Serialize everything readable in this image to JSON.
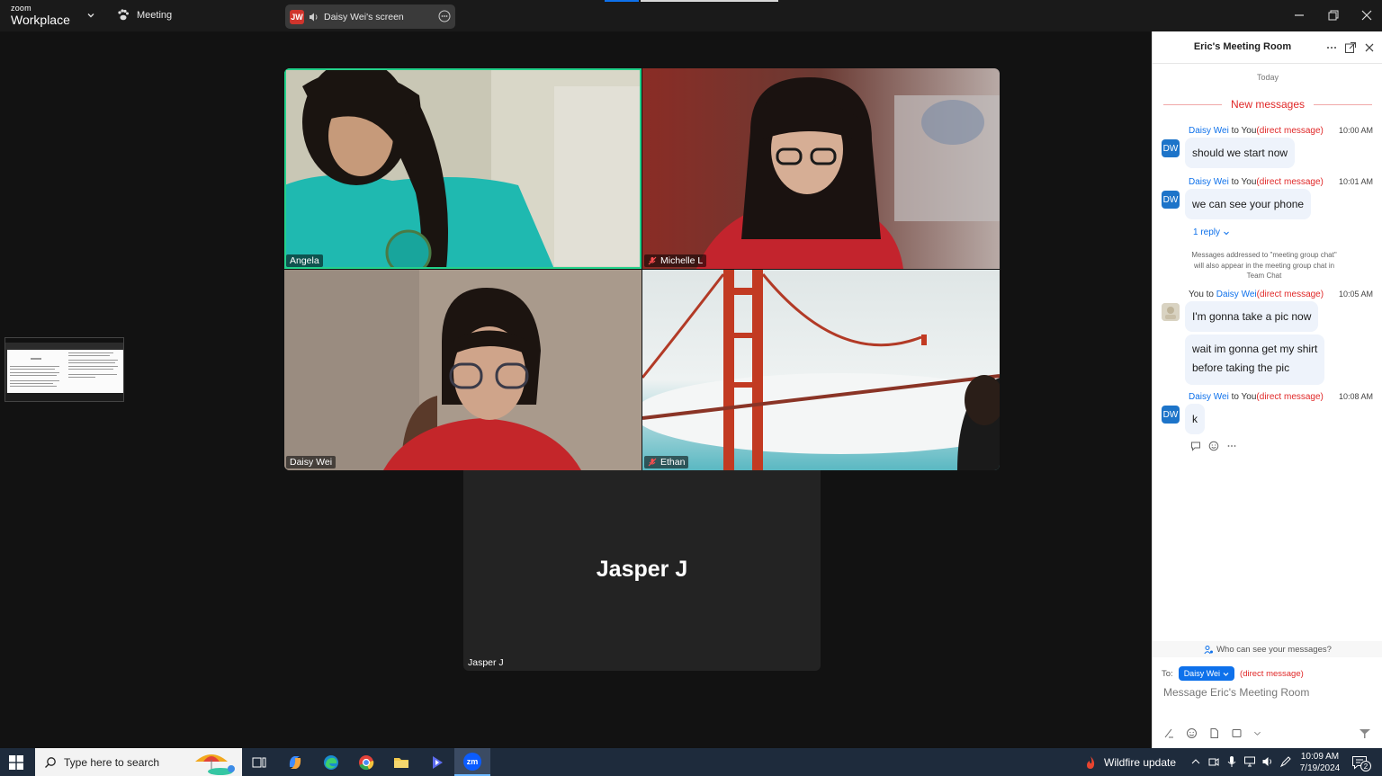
{
  "titlebar": {
    "brand_small": "zoom",
    "brand_big": "Workplace",
    "meeting_label": "Meeting",
    "share": {
      "initials": "JW",
      "label": "Daisy Wei's screen"
    }
  },
  "tiles": [
    {
      "name": "Angela",
      "muted": false,
      "active": true
    },
    {
      "name": "Michelle L",
      "muted": true,
      "active": false
    },
    {
      "name": "Daisy Wei",
      "muted": false,
      "active": false
    },
    {
      "name": "Ethan",
      "muted": true,
      "active": false
    }
  ],
  "jasper": {
    "display_name": "Jasper J",
    "label": "Jasper J"
  },
  "chat": {
    "title": "Eric's Meeting Room",
    "today": "Today",
    "new_messages": "New messages",
    "messages": [
      {
        "sender": "Daisy Wei",
        "to": " to You",
        "dm": "(direct message)",
        "time": "10:00 AM",
        "initials": "DW",
        "text": "should we start now"
      },
      {
        "sender": "Daisy Wei",
        "to": " to You",
        "dm": "(direct message)",
        "time": "10:01 AM",
        "initials": "DW",
        "text": "we can see your phone"
      },
      {
        "sender": "You",
        "to_prefix": " to ",
        "recipient": "Daisy Wei",
        "dm": "(direct message)",
        "time": "10:05 AM",
        "text": "I'm gonna take a pic now",
        "text2_line1": "wait im gonna get my shirt",
        "text2_line2": "before taking the pic"
      },
      {
        "sender": "Daisy Wei",
        "to": " to You",
        "dm": "(direct message)",
        "time": "10:08 AM",
        "initials": "DW",
        "text": "k"
      }
    ],
    "reply_label": "1 reply",
    "notice_line1": "Messages addressed to \"meeting group chat\"",
    "notice_line2": "will also appear in the meeting group chat in",
    "notice_line3": "Team Chat",
    "who_can_see": "Who can see your messages?",
    "to_label": "To:",
    "to_recipient": "Daisy Wei",
    "to_dm": "(direct message)",
    "compose_placeholder": "Message Eric's Meeting Room"
  },
  "taskbar": {
    "search_placeholder": "Type here to search",
    "zoom_icon_text": "zm",
    "news": "Wildfire update",
    "time": "10:09 AM",
    "date": "7/19/2024",
    "notif_count": "2"
  },
  "colors": {
    "accent": "#0e71eb",
    "dm_red": "#e02828",
    "active_speaker": "#23d18b",
    "taskbar": "#1e2b3c"
  }
}
